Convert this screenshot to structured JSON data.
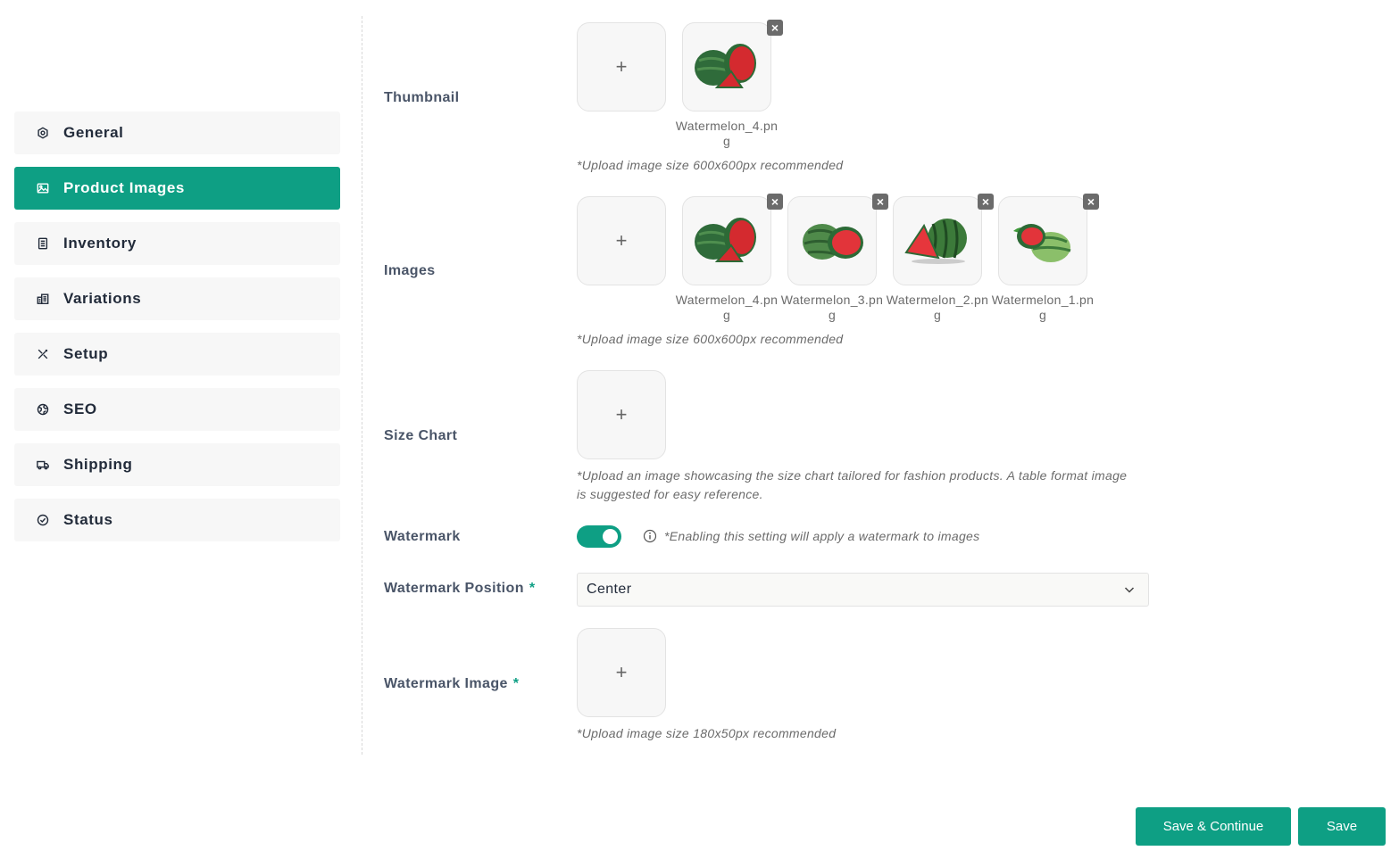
{
  "sidebar": {
    "items": [
      {
        "label": "General",
        "icon": "hexagon-gear-icon",
        "active": false
      },
      {
        "label": "Product Images",
        "icon": "image-icon",
        "active": true
      },
      {
        "label": "Inventory",
        "icon": "document-icon",
        "active": false
      },
      {
        "label": "Variations",
        "icon": "variations-icon",
        "active": false
      },
      {
        "label": "Setup",
        "icon": "tools-icon",
        "active": false
      },
      {
        "label": "SEO",
        "icon": "globe-icon",
        "active": false
      },
      {
        "label": "Shipping",
        "icon": "truck-icon",
        "active": false
      },
      {
        "label": "Status",
        "icon": "check-circle-icon",
        "active": false
      }
    ]
  },
  "form": {
    "thumbnail": {
      "label": "Thumbnail",
      "add_label": "+",
      "files": [
        "Watermelon_4.png"
      ],
      "hint": "*Upload image size 600x600px recommended"
    },
    "images": {
      "label": "Images",
      "add_label": "+",
      "files": [
        "Watermelon_4.png",
        "Watermelon_3.png",
        "Watermelon_2.png",
        "Watermelon_1.png"
      ],
      "hint": "*Upload image size 600x600px recommended"
    },
    "size_chart": {
      "label": "Size Chart",
      "add_label": "+",
      "hint_line1": "*Upload an image showcasing the size chart tailored for fashion products. A table format image",
      "hint_line2": "is suggested for easy reference."
    },
    "watermark": {
      "label": "Watermark",
      "enabled": true,
      "hint": "*Enabling this setting will apply a watermark to images"
    },
    "watermark_position": {
      "label": "Watermark Position",
      "required_mark": "*",
      "value": "Center"
    },
    "watermark_image": {
      "label": "Watermark Image",
      "required_mark": "*",
      "add_label": "+",
      "hint": "*Upload image size 180x50px recommended"
    }
  },
  "footer": {
    "save_continue_label": "Save & Continue",
    "save_label": "Save"
  },
  "colors": {
    "accent": "#0e9f84",
    "nav_bg": "#f7f7f7"
  }
}
